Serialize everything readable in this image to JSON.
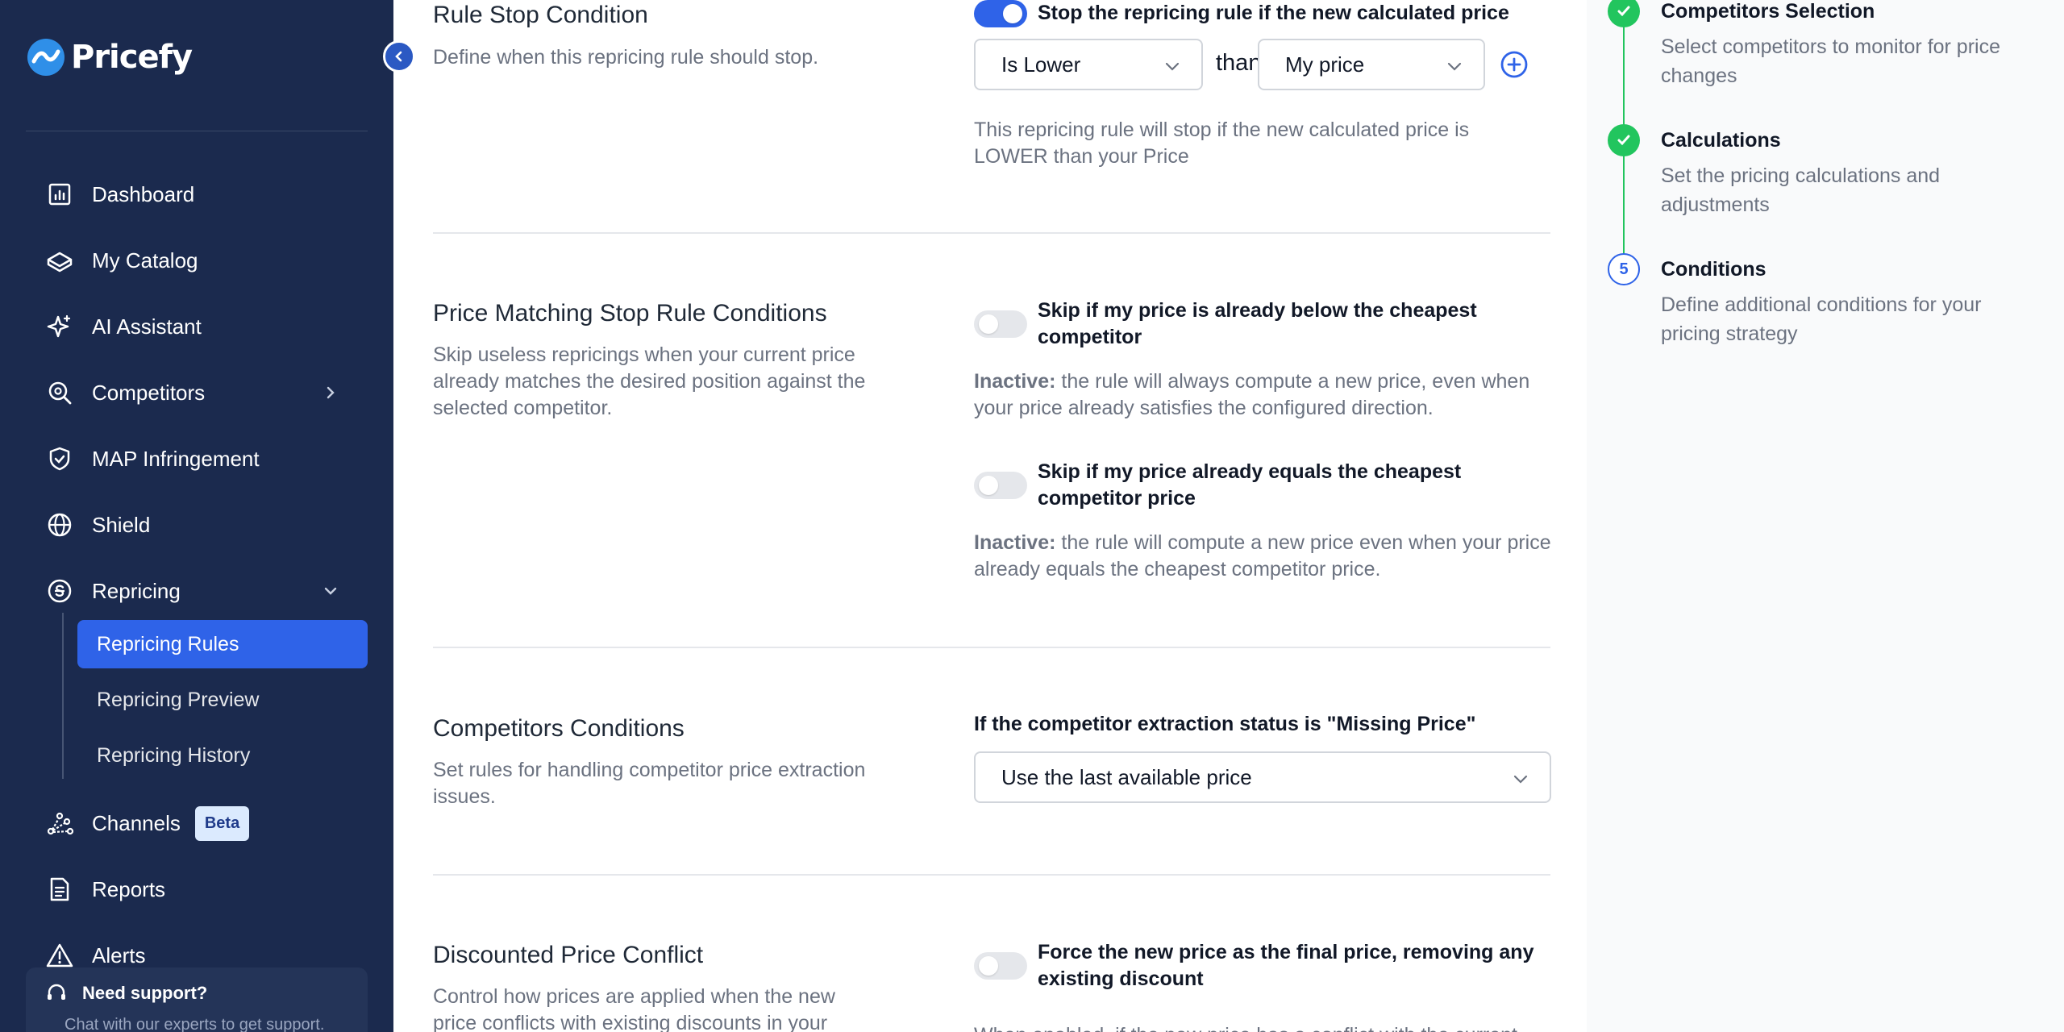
{
  "app": {
    "brand": "Pricefy",
    "accent_color": "#2f63e8",
    "sidebar_color": "#1b2a4e"
  },
  "sidebar": {
    "items": [
      {
        "label": "Dashboard",
        "icon": "bar-chart-icon"
      },
      {
        "label": "My Catalog",
        "icon": "box-icon"
      },
      {
        "label": "AI Assistant",
        "icon": "sparkle-icon"
      },
      {
        "label": "Competitors",
        "icon": "search-icon"
      },
      {
        "label": "MAP Infringement",
        "icon": "shield-check-icon"
      },
      {
        "label": "Shield",
        "icon": "globe-icon"
      },
      {
        "label": "Repricing",
        "icon": "repricing-icon"
      },
      {
        "label": "Channels",
        "icon": "channels-icon",
        "badge": "Beta"
      },
      {
        "label": "Reports",
        "icon": "document-icon"
      },
      {
        "label": "Alerts",
        "icon": "warning-icon"
      }
    ],
    "repricing_subitems": [
      {
        "label": "Repricing Rules",
        "active": true
      },
      {
        "label": "Repricing Preview",
        "active": false
      },
      {
        "label": "Repricing History",
        "active": false
      }
    ],
    "support": {
      "title": "Need support?",
      "subtitle": "Chat with our experts to get support."
    }
  },
  "sections": {
    "rule_stop": {
      "title": "Rule Stop Condition",
      "desc": "Define when this repricing rule should stop.",
      "toggle_label": "Stop the repricing rule if the new calculated price",
      "toggle_on": true,
      "operator": "Is Lower",
      "than": "than",
      "reference": "My price",
      "help": "This repricing rule will stop if the new calculated price is LOWER than your Price"
    },
    "price_matching": {
      "title": "Price Matching Stop Rule Conditions",
      "desc": "Skip useless repricings when your current price already matches the desired position against the selected competitor.",
      "option1_label": "Skip if my price is already below the cheapest competitor",
      "option1_status": "Inactive:",
      "option1_help": " the rule will always compute a new price, even when your price already satisfies the configured direction.",
      "option2_label": "Skip if my price already equals the cheapest competitor price",
      "option2_status": "Inactive:",
      "option2_help": " the rule will compute a new price even when your price already equals the cheapest competitor price."
    },
    "competitors_conditions": {
      "title": "Competitors Conditions",
      "desc": "Set rules for handling competitor price extraction issues.",
      "field_label": "If the competitor extraction status is \"Missing Price\"",
      "selected": "Use the last available price"
    },
    "discounted": {
      "title": "Discounted Price Conflict",
      "desc": "Control how prices are applied when the new price conflicts with existing discounts in your",
      "toggle_label": "Force the new price as the final price, removing any existing discount",
      "help": "When enabled, if the new price has a conflict with the current"
    }
  },
  "steps": [
    {
      "title": "Competitors Selection",
      "desc": "Select competitors to monitor for price changes",
      "status": "done"
    },
    {
      "title": "Calculations",
      "desc": "Set the pricing calculations and adjustments",
      "status": "done"
    },
    {
      "number": "5",
      "title": "Conditions",
      "desc": "Define additional conditions for your pricing strategy",
      "status": "current"
    }
  ]
}
